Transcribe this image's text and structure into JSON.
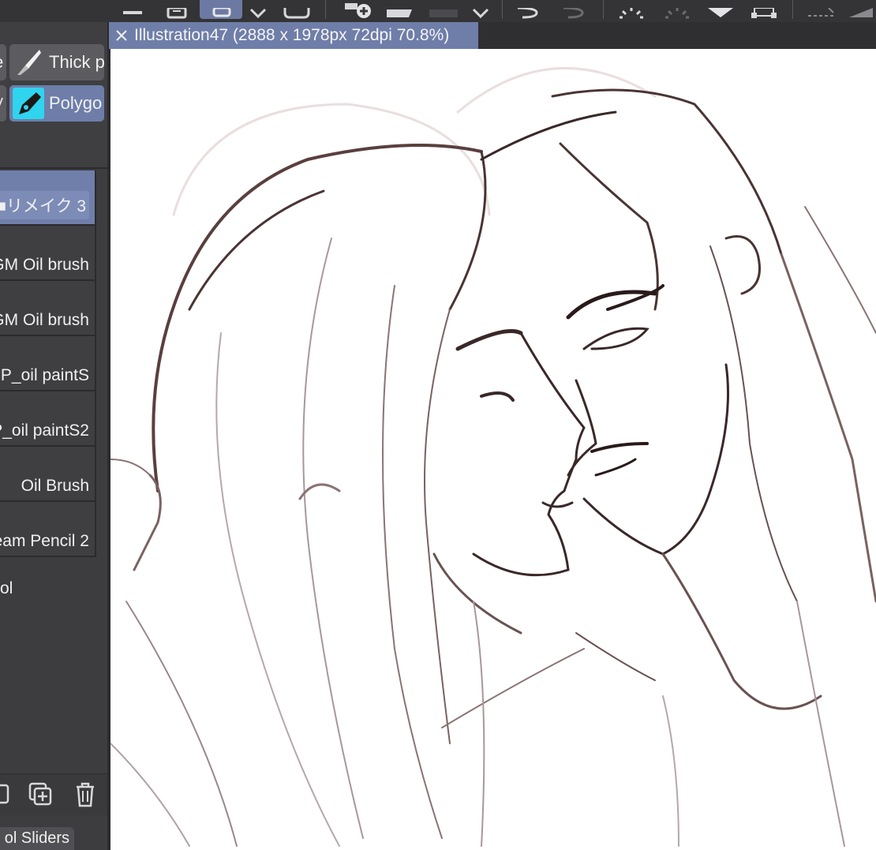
{
  "toolbar": {
    "buttons": [
      "menu-icon",
      "new-file-icon",
      "lasso-select-icon",
      "chevron-down-icon",
      "camera-icon",
      "add-layer-icon",
      "folder-icon",
      "color-swatch-icon",
      "chevron-down-icon",
      "undo-icon",
      "redo-icon",
      "loading-icon",
      "loading-icon",
      "fill-icon",
      "transform-icon",
      "dashed-select-icon",
      "ruler-icon"
    ],
    "active_button": "lasso-select-icon"
  },
  "subtools": {
    "row1": {
      "partial_label": "e",
      "label": "Thick p"
    },
    "row2": {
      "partial_label": "V",
      "label": "Polygo"
    }
  },
  "brushes": [
    {
      "label": "■リメイク 3",
      "selected": true
    },
    {
      "label": "GM Oil brush",
      "selected": false
    },
    {
      "label": "GM Oil brush",
      "selected": false
    },
    {
      "label": "P_oil paintS",
      "selected": false
    },
    {
      "label": "P_oil paintS2",
      "selected": false
    },
    {
      "label": "Oil Brush",
      "selected": false
    },
    {
      "label": "eam Pencil 2",
      "selected": false
    }
  ],
  "panel_extra_label": "ol",
  "panel_bottom": {
    "icons": [
      "duplicate-icon",
      "add-copy-icon",
      "trash-icon"
    ]
  },
  "slider_tab": "ol Sliders",
  "document": {
    "tab_title": "Illustration47 (2888 x 1978px 72dpi 70.8%)"
  },
  "colors": {
    "accent": "#6f7ea8",
    "polygon_icon": "#2fd4ef",
    "panel_bg": "#3f3f42",
    "sketch_line": "#4a3434"
  }
}
